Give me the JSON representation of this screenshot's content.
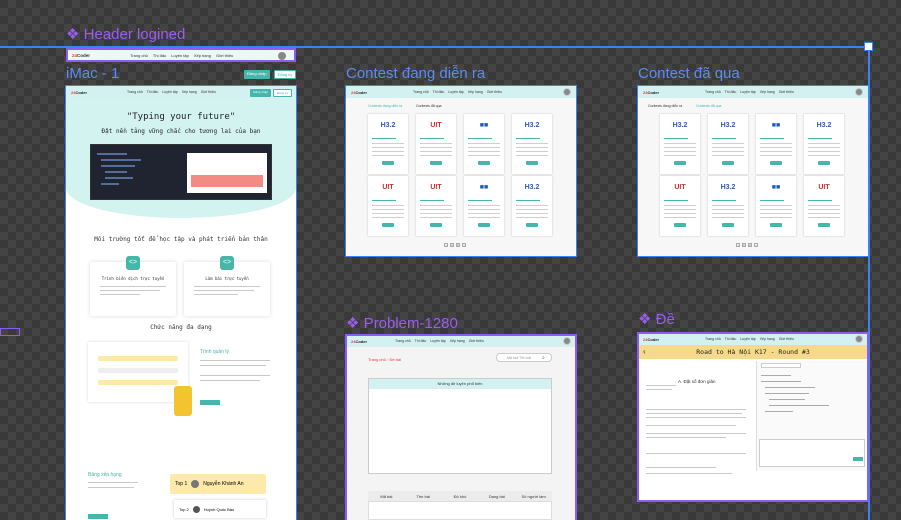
{
  "canvas": {
    "header_component_label": "❖ Header logined",
    "frames": {
      "imac": "iMac - 1",
      "contest_running": "Contest đang diễn ra",
      "contest_past": "Contest đã qua",
      "problem": "❖ Problem-1280",
      "de": "❖ Đề"
    },
    "colors": {
      "selection": "#3b82f6",
      "component": "#8b5cf6",
      "accent": "#44b6ab",
      "header_bg": "#d3f1f1"
    }
  },
  "site": {
    "logo_prefix": "24",
    "logo_suffix": "Coder",
    "nav": [
      "Trang chủ",
      "Thi đấu",
      "Luyện tập",
      "Xếp hạng",
      "Giới thiệu"
    ],
    "login": "Đăng nhập",
    "register": "Đăng ký"
  },
  "home": {
    "hero_title": "\"Typing your future\"",
    "hero_subtitle": "Đặt nền tảng vững chắc cho tương lai của bạn",
    "env_title": "Môi trường tốt để học tập và phát triển bản thân",
    "card1_title": "Trình biên dịch trực tuyến",
    "card2_title": "Làm bài trực tuyến",
    "features_title": "Chức năng đa dạng",
    "features_sub": "Trình quản lý",
    "ranking_title": "Bảng xếp hạng",
    "rank1_label": "Top 1",
    "rank1_name": "Nguyễn Khánh An",
    "rank2_label": "Top 2",
    "rank2_name": "Huỳnh Quốc Bảo"
  },
  "contests": {
    "tab_running": "Contests đang diễn ra",
    "tab_past": "Contests đã qua",
    "thumb_text": "H3.2"
  },
  "problem": {
    "breadcrumb_home": "Trang chủ",
    "breadcrumb_current": "Đề bài",
    "search_placeholder": "Mã bài/ Tên bài",
    "panel_title": "Những đề luyện phổ biến",
    "columns": [
      "Mã bài",
      "Tên bài",
      "Độ khó",
      "Dạng bài",
      "Số người làm"
    ]
  },
  "de": {
    "title": "Road to Hà Nội K17 - Round #3",
    "problem_title": "A. Đặt số đơn giản"
  }
}
